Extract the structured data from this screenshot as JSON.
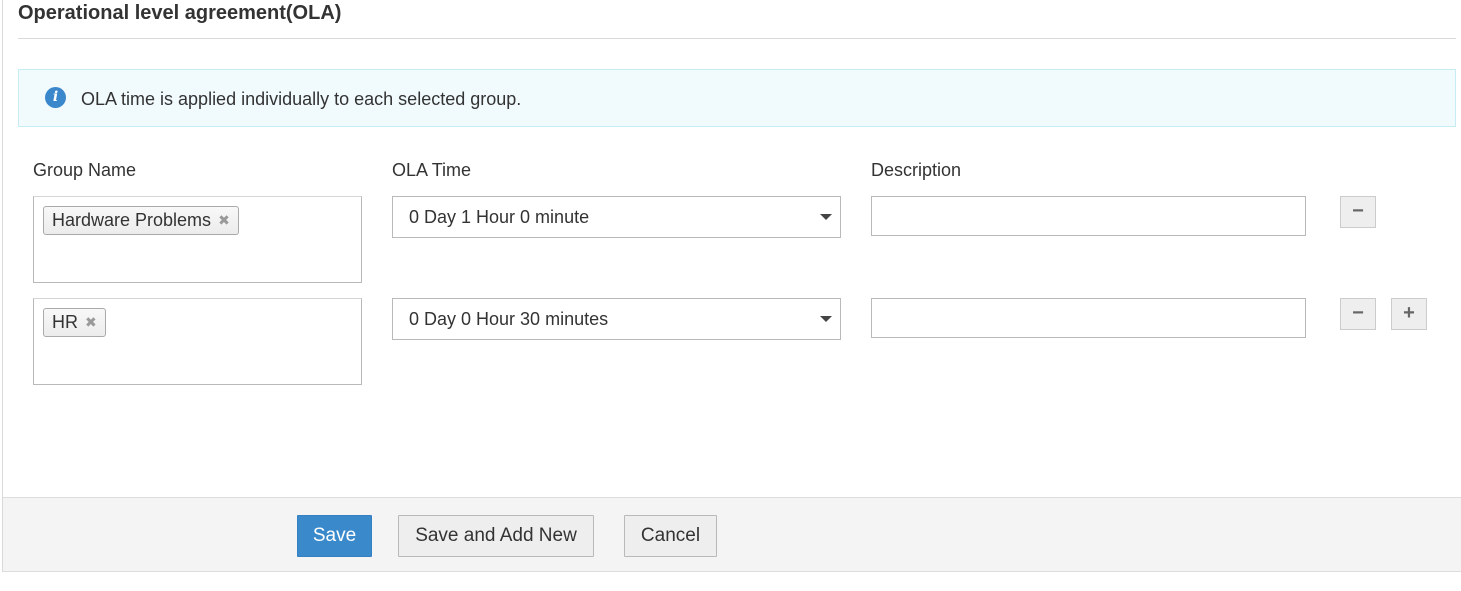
{
  "section": {
    "title": "Operational level agreement(OLA)"
  },
  "info": {
    "icon": "info-icon",
    "message": "OLA time is applied individually to each selected group."
  },
  "columns": {
    "group_name": "Group Name",
    "ola_time": "OLA Time",
    "description": "Description"
  },
  "rows": [
    {
      "groups": [
        "Hardware Problems"
      ],
      "ola_time": "0 Day 1 Hour 0 minute",
      "description": ""
    },
    {
      "groups": [
        "HR"
      ],
      "ola_time": "0 Day 0 Hour 30 minutes",
      "description": ""
    }
  ],
  "row_buttons": {
    "remove": "−",
    "add": "+"
  },
  "footer": {
    "save": "Save",
    "save_and_add_new": "Save and Add New",
    "cancel": "Cancel"
  },
  "colors": {
    "primary": "#3a8acb",
    "info_background": "#f1fafd",
    "info_border": "#c6ecf4",
    "info_icon": "#3a87cc"
  }
}
